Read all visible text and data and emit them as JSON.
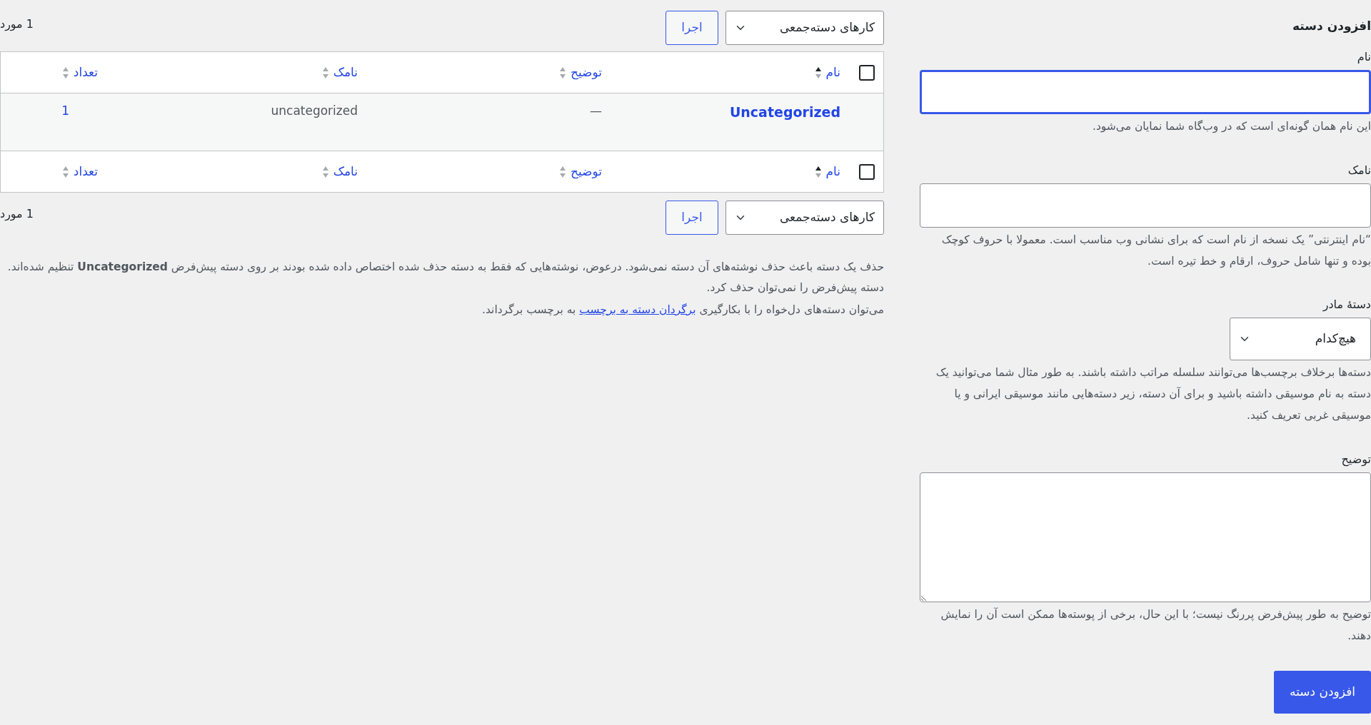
{
  "table_panel": {
    "top_bar": {
      "bulk_actions": {
        "value": "کارهای دسته‌جمعی"
      },
      "apply_button": "اجرا",
      "item_count": "1 مورد"
    },
    "columns": [
      {
        "kind": "checkbox",
        "checked": false
      },
      {
        "kind": "sortable",
        "label": "نام",
        "sorted": true
      },
      {
        "kind": "sortable",
        "label": "توضیح",
        "sorted": false
      },
      {
        "kind": "sortable",
        "label": "نامک",
        "sorted": false
      },
      {
        "kind": "sortable",
        "label": "تعداد",
        "sorted": false
      }
    ],
    "rows": [
      {
        "name": "Uncategorized",
        "description": "—",
        "slug": "uncategorized",
        "count": "1"
      }
    ],
    "footer_columns": [
      {
        "kind": "checkbox",
        "checked": false
      },
      {
        "kind": "sortable",
        "label": "نام",
        "sorted": true
      },
      {
        "kind": "sortable",
        "label": "توضیح",
        "sorted": false
      },
      {
        "kind": "sortable",
        "label": "نامک",
        "sorted": false
      },
      {
        "kind": "sortable",
        "label": "تعداد",
        "sorted": false
      }
    ],
    "bottom_bar": {
      "bulk_actions": {
        "value": "کارهای دسته‌جمعی"
      },
      "apply_button": "اجرا",
      "item_count": "1 مورد"
    },
    "notes": [
      {
        "text": "حذف یک دسته باعث حذف نوشته‌های آن دسته نمی‌شود. درعوض، نوشته‌هایی که فقط به دسته حذف شده اختصاص داده شده بودند بر روی دسته پیش‌فرض **Uncategorized** تنظیم شده‌اند. دسته پیش‌فرض را نمی‌توان حذف کرد."
      },
      {
        "before": "می‌توان دسته‌های دل‌خواه را با بکارگیری",
        "link": "برگردان دسته به برچسب",
        "after": "به برچسب برگرداند."
      }
    ]
  },
  "form": {
    "heading": "افزودن دسته",
    "fields": [
      {
        "kind": "input",
        "label": "نام",
        "focused": true,
        "help": "این نام همان گونه‌ای است که در وب‌گاه شما نمایان می‌شود."
      },
      {
        "kind": "input",
        "label": "نامک",
        "focused": false,
        "help": "“نام اینترنتی” یک نسخه از نام است که برای نشانی وب مناسب است. معمولا با حروف کوچک بوده و تنها شامل حروف، ارقام و خط تیره است."
      },
      {
        "kind": "select",
        "label": "دستهٔ مادر",
        "value": "هیچ‌کدام",
        "help": "دسته‌ها برخلاف برچسب‌ها می‌توانند سلسله مراتب داشته باشند. به طور مثال شما می‌توانید یک دسته به نام موسیقی داشته باشید و برای آن دسته، زیر دسته‌هایی مانند موسیقی ایرانی و یا موسیقی غربی تعریف کنید."
      },
      {
        "kind": "textarea",
        "label": "توضیح",
        "help": "توضیح به طور پیش‌فرض پررنگ نیست؛ با این حال، برخی از پوسته‌ها ممکن است آن را نمایش دهند."
      }
    ],
    "submit_button": "افزودن دسته"
  }
}
